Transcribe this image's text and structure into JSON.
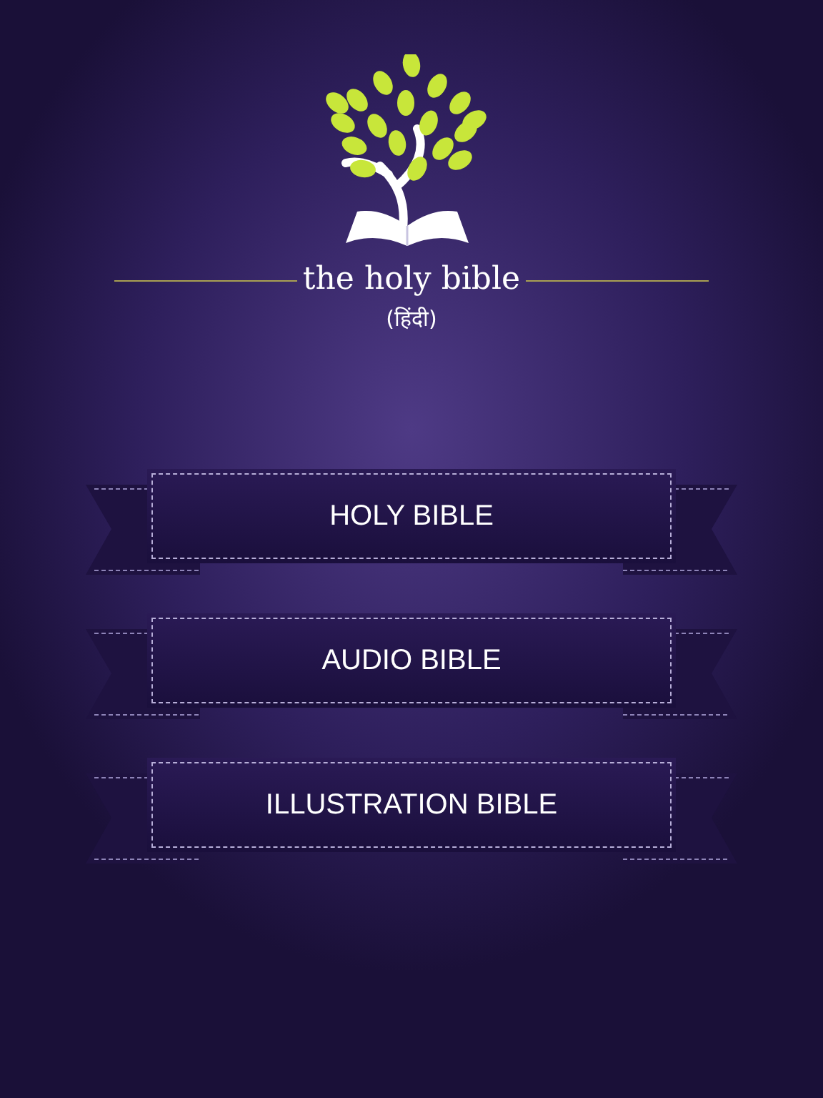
{
  "logo": {
    "title": "the holy bible",
    "subtitle": "(हिंदी)"
  },
  "menu": [
    {
      "label": "HOLY BIBLE"
    },
    {
      "label": "AUDIO BIBLE"
    },
    {
      "label": "ILLUSTRATION BIBLE"
    }
  ]
}
